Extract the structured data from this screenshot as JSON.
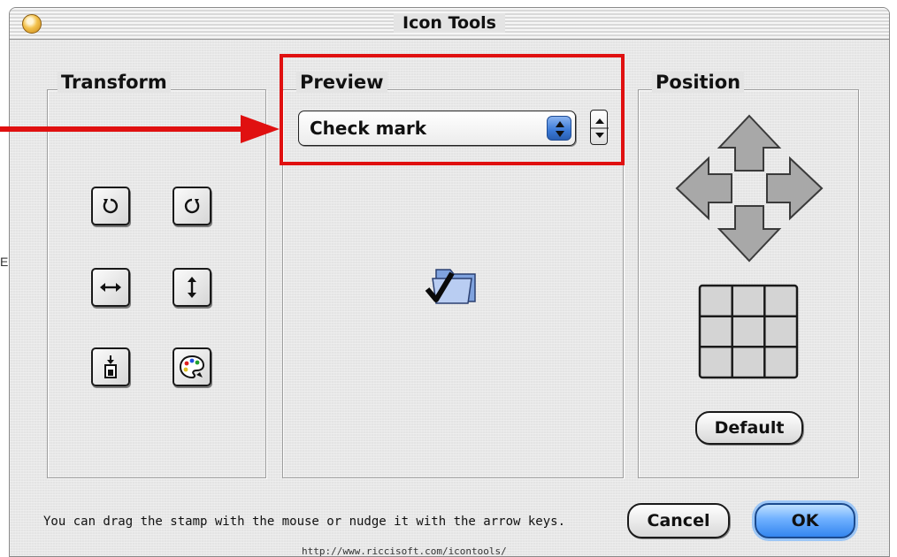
{
  "window": {
    "title": "Icon Tools"
  },
  "transform": {
    "label": "Transform",
    "tools": [
      {
        "name": "rotate-left-button",
        "icon": "rotate-left-icon"
      },
      {
        "name": "rotate-right-button",
        "icon": "rotate-right-icon"
      },
      {
        "name": "flip-horizontal-button",
        "icon": "flip-horizontal-icon"
      },
      {
        "name": "flip-vertical-button",
        "icon": "flip-vertical-icon"
      },
      {
        "name": "stamp-position-button",
        "icon": "stamp-position-icon"
      },
      {
        "name": "color-palette-button",
        "icon": "palette-icon"
      }
    ]
  },
  "preview": {
    "label": "Preview",
    "popup_value": "Check mark",
    "icon": "folder-with-checkmark-icon"
  },
  "position": {
    "label": "Position",
    "arrows": [
      "up",
      "left",
      "right",
      "down"
    ],
    "grid_cells": 9,
    "default_button": "Default"
  },
  "footer": {
    "hint": "You can drag the stamp with the mouse or nudge it with the arrow keys.",
    "cancel_label": "Cancel",
    "ok_label": "OK",
    "url": "http://www.riccisoft.com/icontools/"
  },
  "annotation": {
    "highlight_color": "#e01010"
  },
  "edge_marks": [
    "E"
  ]
}
